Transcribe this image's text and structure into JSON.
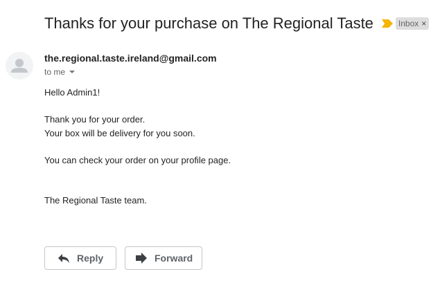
{
  "email": {
    "subject": "Thanks for your purchase on The Regional Taste",
    "label": "Inbox",
    "label_remove": "×",
    "sender": "the.regional.taste.ireland@gmail.com",
    "recipient": "to me",
    "body": [
      "Hello Admin1!",
      "",
      "Thank you for your order.",
      "Your box will be delivery for you soon.",
      "",
      "You can check your order on your profile page.",
      "",
      "",
      "The Regional Taste team."
    ]
  },
  "actions": {
    "reply_label": "Reply",
    "forward_label": "Forward"
  },
  "icons": {
    "importance": "importance-marker-icon",
    "avatar": "default-avatar-icon",
    "reply": "reply-arrow-icon",
    "forward": "forward-arrow-icon"
  },
  "colors": {
    "importance": "#f4b400",
    "chip_bg": "#dddddd",
    "avatar_bg": "#f1f3f4",
    "avatar_glyph": "#c4c8cc"
  }
}
